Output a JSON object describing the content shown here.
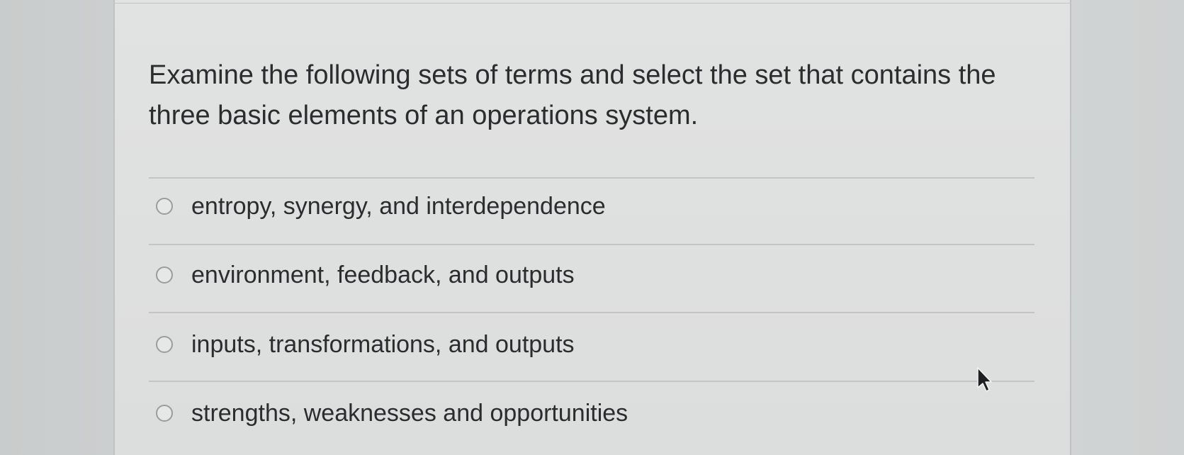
{
  "question": {
    "text": "Examine the following sets of terms and select the set that contains the three basic elements of an operations system."
  },
  "options": [
    {
      "label": "entropy, synergy, and interdependence",
      "selected": false
    },
    {
      "label": "environment, feedback, and outputs",
      "selected": false
    },
    {
      "label": "inputs, transformations, and outputs",
      "selected": false
    },
    {
      "label": "strengths, weaknesses and opportunities",
      "selected": false
    }
  ],
  "icons": {
    "cursor": "mouse-pointer-icon",
    "radio": "radio-button-icon"
  },
  "colors": {
    "text": "#2b2c2e",
    "panel": "#dfe0e0",
    "divider": "#c3c5c5",
    "radio_border": "#9a9c9e"
  }
}
